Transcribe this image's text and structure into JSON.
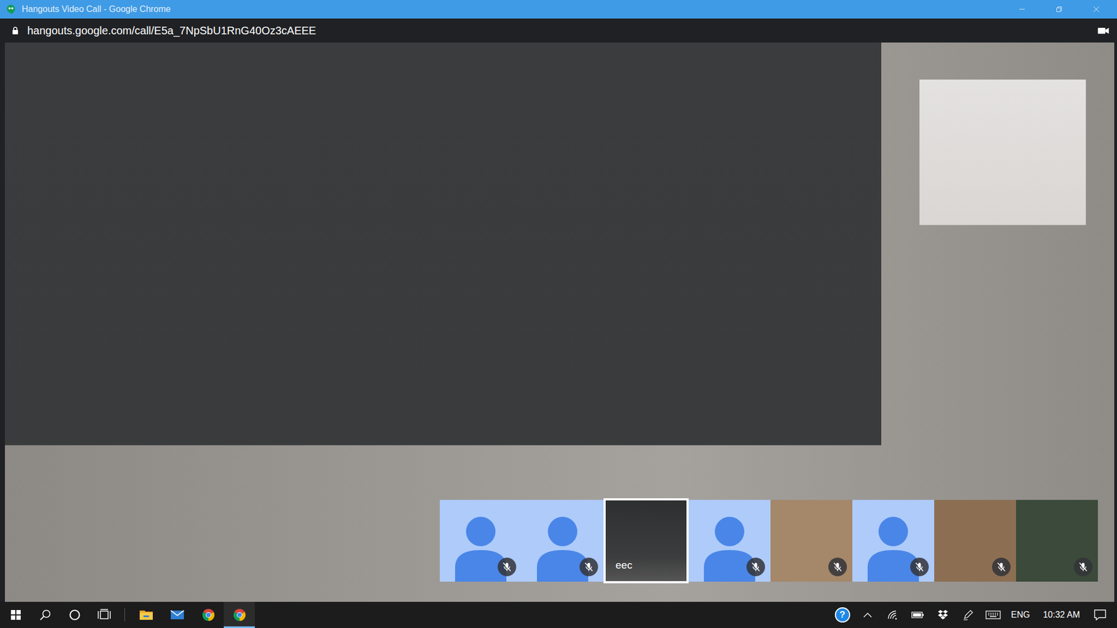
{
  "window": {
    "title": "Hangouts Video Call - Google Chrome"
  },
  "address_bar": {
    "url": "hangouts.google.com/call/E5a_7NpSbU1RnG40Oz3cAEEE",
    "secure": true
  },
  "participants": [
    {
      "kind": "avatar",
      "muted": true,
      "selected": false
    },
    {
      "kind": "avatar",
      "muted": true,
      "selected": false
    },
    {
      "kind": "video",
      "label": "eec",
      "muted": false,
      "selected": true
    },
    {
      "kind": "avatar",
      "muted": true,
      "selected": false
    },
    {
      "kind": "photo",
      "color": "#a5876a",
      "muted": true,
      "selected": false
    },
    {
      "kind": "avatar",
      "muted": true,
      "selected": false
    },
    {
      "kind": "photo",
      "color": "#8c6f52",
      "muted": true,
      "selected": false
    },
    {
      "kind": "photo",
      "color": "#3b4a3a",
      "muted": true,
      "selected": false
    }
  ],
  "taskbar": {
    "pinned": [
      {
        "kind": "explorer",
        "selected": false
      },
      {
        "kind": "mail",
        "selected": false
      },
      {
        "kind": "chrome",
        "selected": false
      },
      {
        "kind": "chrome",
        "selected": true
      }
    ],
    "tray": {
      "help": "?",
      "language": "ENG",
      "time": "10:32 AM"
    }
  }
}
